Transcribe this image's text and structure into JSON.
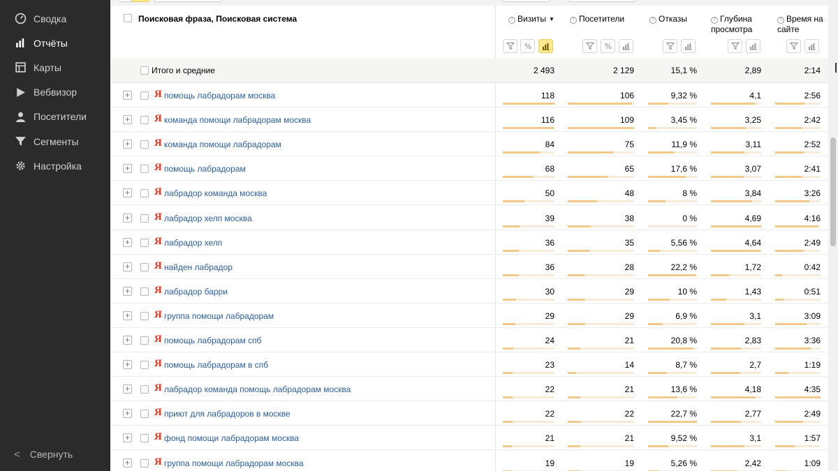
{
  "sidebar": {
    "items": [
      {
        "label": "Сводка",
        "icon": "dashboard-icon"
      },
      {
        "label": "Отчёты",
        "icon": "bar-chart-icon"
      },
      {
        "label": "Карты",
        "icon": "map-icon"
      },
      {
        "label": "Вебвизор",
        "icon": "play-icon"
      },
      {
        "label": "Посетители",
        "icon": "person-icon"
      },
      {
        "label": "Сегменты",
        "icon": "funnel-icon"
      },
      {
        "label": "Настройка",
        "icon": "gear-icon"
      }
    ],
    "active_index": 1,
    "collapse_label": "Свернуть"
  },
  "table": {
    "dimension_header": "Поисковая фраза, Поисковая система",
    "columns": [
      {
        "label": "Визиты",
        "sorted": true,
        "sort_glyph": "▼"
      },
      {
        "label": "Посетители"
      },
      {
        "label": "Отказы"
      },
      {
        "label": "Глубина просмотра"
      },
      {
        "label": "Время на сайте"
      }
    ],
    "totals": {
      "label": "Итого и средние",
      "values": [
        "2 493",
        "2 129",
        "15,1 %",
        "2,89",
        "2:14"
      ]
    },
    "rows": [
      {
        "phrase": "помощь лабрадорам москва",
        "values": [
          "118",
          "106",
          "9,32 %",
          "4,1",
          "2:56"
        ]
      },
      {
        "phrase": "команда помощи лабрадорам москва",
        "values": [
          "116",
          "109",
          "3,45 %",
          "3,25",
          "2:42"
        ]
      },
      {
        "phrase": "команда помощи лабрадорам",
        "values": [
          "84",
          "75",
          "11,9 %",
          "3,11",
          "2:52"
        ]
      },
      {
        "phrase": "помощь лабрадорам",
        "values": [
          "68",
          "65",
          "17,6 %",
          "3,07",
          "2:41"
        ]
      },
      {
        "phrase": "лабрадор команда москва",
        "values": [
          "50",
          "48",
          "8 %",
          "3,84",
          "3:26"
        ]
      },
      {
        "phrase": "лабрадор хелп москва",
        "values": [
          "39",
          "38",
          "0 %",
          "4,69",
          "4:16"
        ]
      },
      {
        "phrase": "лабрадор хелп",
        "values": [
          "36",
          "35",
          "5,56 %",
          "4,64",
          "2:49"
        ]
      },
      {
        "phrase": "найден лабрадор",
        "values": [
          "36",
          "28",
          "22,2 %",
          "1,72",
          "0:42"
        ]
      },
      {
        "phrase": "лабрадор барри",
        "values": [
          "30",
          "29",
          "10 %",
          "1,43",
          "0:51"
        ]
      },
      {
        "phrase": "группа помощи лабрадорам",
        "values": [
          "29",
          "29",
          "6,9 %",
          "3,1",
          "3:09"
        ]
      },
      {
        "phrase": "помощь лабрадорам спб",
        "values": [
          "24",
          "21",
          "20,8 %",
          "2,83",
          "3:36"
        ]
      },
      {
        "phrase": "помощь лабрадорам в спб",
        "values": [
          "23",
          "14",
          "8,7 %",
          "2,7",
          "1:19"
        ]
      },
      {
        "phrase": "лабрадор команда помощь лабрадорам москва",
        "values": [
          "22",
          "21",
          "13,6 %",
          "4,18",
          "4:35"
        ]
      },
      {
        "phrase": "приют для лабрадоров в москве",
        "values": [
          "22",
          "22",
          "22,7 %",
          "2,77",
          "2:49"
        ]
      },
      {
        "phrase": "фонд помощи лабрадорам москва",
        "values": [
          "21",
          "21",
          "9,52 %",
          "3,1",
          "1:57"
        ]
      },
      {
        "phrase": "группа помощи лабрадорам москва",
        "values": [
          "19",
          "19",
          "5,26 %",
          "2,42",
          "1:09"
        ]
      }
    ]
  },
  "colors": {
    "sidebar_bg": "#2b2b2b",
    "link": "#2a5d9f",
    "yandex_logo": "#e8321e",
    "bar": "#f1c98a",
    "active_tool": "#fde98b"
  }
}
